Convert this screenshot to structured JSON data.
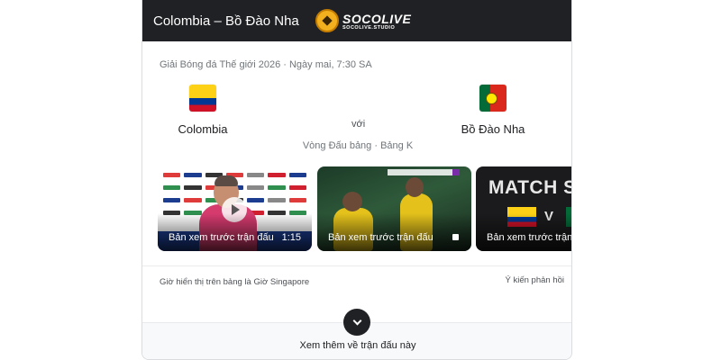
{
  "header": {
    "title": "Colombia – Bồ Đào Nha",
    "logo": {
      "name": "SOCOLIVE",
      "sub": "SOCOLIVE.STUDIO"
    }
  },
  "match": {
    "meta": "Giải Bóng đá Thế giới 2026 · Ngày mai, 7:30 SA",
    "home_team": {
      "name": "Colombia",
      "flag_icon": "colombia-flag-icon"
    },
    "away_team": {
      "name": "Bồ Đào Nha",
      "flag_icon": "portugal-flag-icon"
    },
    "vs_label": "với",
    "round": "Vòng Đấu bảng · Bảng K"
  },
  "videos": [
    {
      "label": "Bản xem trước trận đấu",
      "duration": "1:15"
    },
    {
      "label": "Bản xem trước trận đấu",
      "duration": ""
    },
    {
      "label": "Bản xem trước trận đấu",
      "duration": "",
      "thumbnail_text": "MATCH ST",
      "thumbnail_v": "V"
    }
  ],
  "footer": {
    "timezone_note": "Giờ hiển thị trên bảng là Giờ Singapore",
    "feedback_label": "Ý kiến phản hồi",
    "more_label": "Xem thêm về trận đấu này"
  },
  "colors": {
    "header_bg": "#202124",
    "text_primary": "#202124",
    "text_secondary": "#70757a"
  }
}
